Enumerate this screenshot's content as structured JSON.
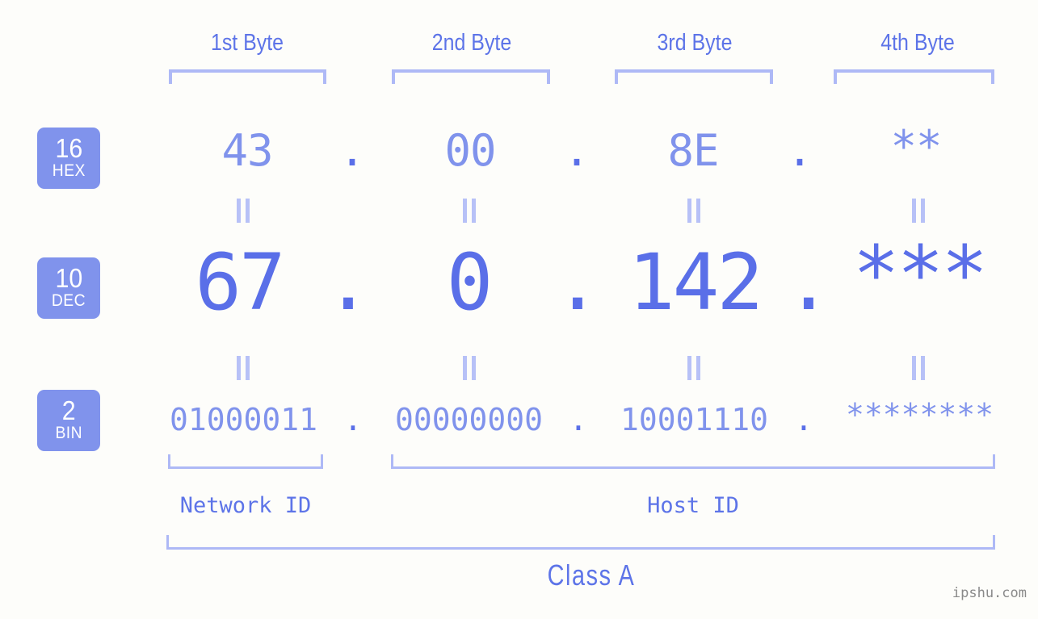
{
  "colors": {
    "background": "#fdfdfa",
    "accent_light": "#8093ec",
    "accent_dark": "#5a6fe8",
    "bracket": "#aeb9f6",
    "badge_bg": "#8093ec",
    "badge_text": "#ffffff",
    "eq_mark": "#b7c1f7",
    "watermark": "#8a8a8a"
  },
  "byte_headers": [
    {
      "label": "1st Byte"
    },
    {
      "label": "2nd Byte"
    },
    {
      "label": "3rd Byte"
    },
    {
      "label": "4th Byte"
    }
  ],
  "rows": [
    {
      "base_number": "16",
      "base_name": "HEX",
      "values": [
        "43",
        "00",
        "8E",
        "**"
      ],
      "separator": "."
    },
    {
      "base_number": "10",
      "base_name": "DEC",
      "values": [
        "67",
        "0",
        "142",
        "***"
      ],
      "separator": "."
    },
    {
      "base_number": "2",
      "base_name": "BIN",
      "values": [
        "01000011",
        "00000000",
        "10001110",
        "********"
      ],
      "separator": "."
    }
  ],
  "equality_marks": {
    "symbol": "="
  },
  "sections": [
    {
      "label": "Network ID"
    },
    {
      "label": "Host ID"
    }
  ],
  "class_label": "Class A",
  "watermark": "ipshu.com"
}
